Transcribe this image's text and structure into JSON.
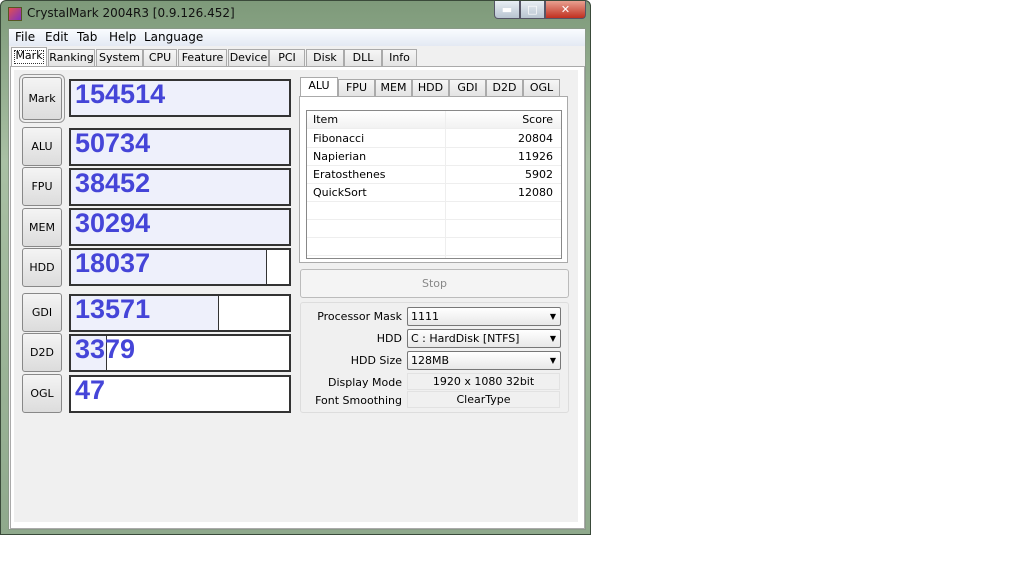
{
  "window": {
    "title": "CrystalMark 2004R3 [0.9.126.452]",
    "minimize": "▬",
    "maximize": "□",
    "close": "✕"
  },
  "menu": [
    "File",
    "Edit",
    "Tab",
    "Help",
    "Language"
  ],
  "tabs": [
    "Mark",
    "Ranking",
    "System",
    "CPU",
    "Feature",
    "Device",
    "PCI",
    "Disk",
    "DLL",
    "Info"
  ],
  "active_tab": "Mark",
  "scores": [
    {
      "label": "Mark",
      "value": "154514",
      "fill": 1.0
    },
    {
      "label": "ALU",
      "value": "50734",
      "fill": 1.0
    },
    {
      "label": "FPU",
      "value": "38452",
      "fill": 1.0
    },
    {
      "label": "MEM",
      "value": "30294",
      "fill": 1.0
    },
    {
      "label": "HDD",
      "value": "18037",
      "fill": 0.9
    },
    {
      "label": "GDI",
      "value": "13571",
      "fill": 0.68
    },
    {
      "label": "D2D",
      "value": "3379",
      "fill": 0.165
    },
    {
      "label": "OGL",
      "value": "47",
      "fill": 0.0
    }
  ],
  "subtabs": [
    "ALU",
    "FPU",
    "MEM",
    "HDD",
    "GDI",
    "D2D",
    "OGL"
  ],
  "active_subtab": "ALU",
  "table": {
    "headers": [
      "Item",
      "Score"
    ],
    "rows": [
      [
        "Fibonacci",
        "20804"
      ],
      [
        "Napierian",
        "11926"
      ],
      [
        "Eratosthenes",
        "5902"
      ],
      [
        "QuickSort",
        "12080"
      ]
    ]
  },
  "stop_label": "Stop",
  "settings": {
    "processor_mask": {
      "label": "Processor Mask",
      "value": "1111"
    },
    "hdd": {
      "label": "HDD",
      "value": "C : HardDisk [NTFS]"
    },
    "hdd_size": {
      "label": "HDD Size",
      "value": "128MB"
    },
    "display_mode": {
      "label": "Display Mode",
      "value": "1920 x 1080 32bit"
    },
    "font_smoothing": {
      "label": "Font Smoothing",
      "value": "ClearType"
    }
  },
  "colors": {
    "score_text": "#4545d8",
    "bar_fill": "#eef0fb"
  }
}
